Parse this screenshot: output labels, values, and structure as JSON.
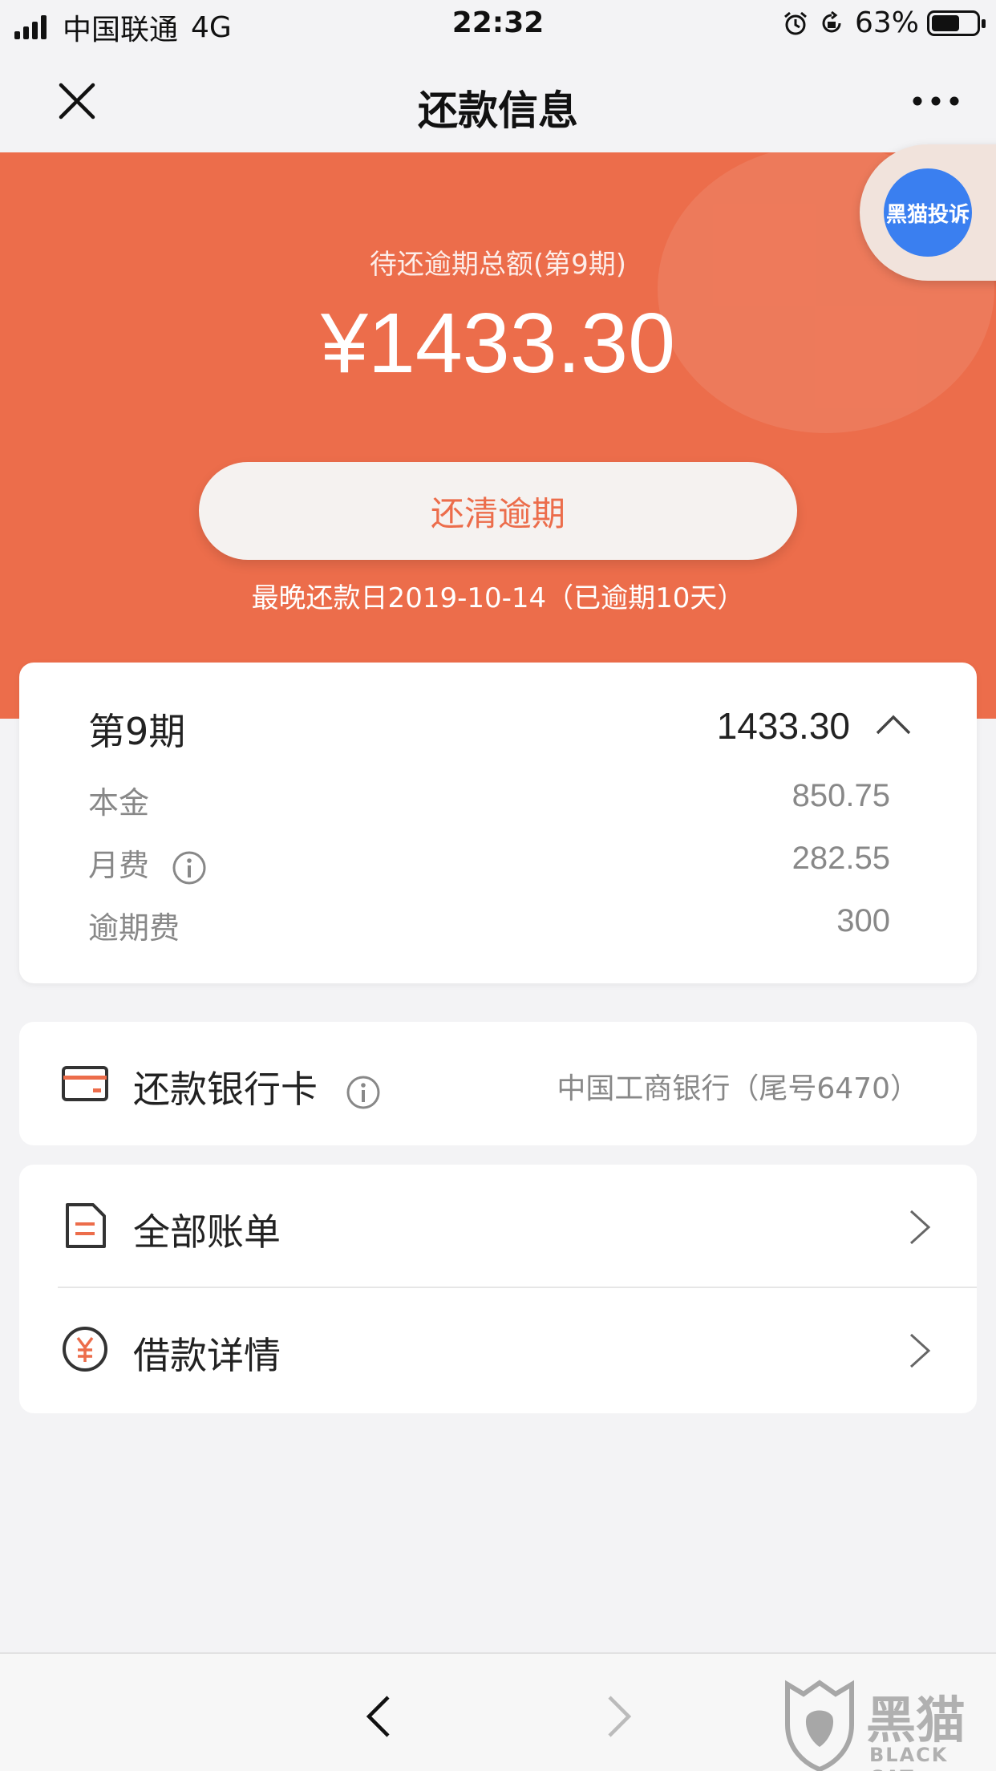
{
  "status_bar": {
    "carrier": "中国联通",
    "network": "4G",
    "time": "22:32",
    "battery": "63%",
    "battery_level": 0.63
  },
  "nav": {
    "title": "还款信息",
    "icons": [
      "close-icon",
      "more-icon"
    ]
  },
  "hero": {
    "label": "待还逾期总额(第9期)",
    "amount": "¥1433.30",
    "pay_button": "还清逾期",
    "due_note": "最晚还款日2019-10-14（已逾期10天）",
    "accent_color": "#ec6d4b"
  },
  "complaint_badge": {
    "label": "黑猫投诉",
    "color": "#3a7ff0"
  },
  "period": {
    "title": "第9期",
    "total": "1433.30",
    "rows": [
      {
        "label": "本金",
        "value": "850.75"
      },
      {
        "label": "月费",
        "value": "282.55"
      },
      {
        "label": "逾期费",
        "value": "300"
      }
    ]
  },
  "bank": {
    "label": "还款银行卡",
    "value": "中国工商银行（尾号6470）"
  },
  "menu": {
    "items": [
      {
        "label": "全部账单",
        "icon": "bill-icon"
      },
      {
        "label": "借款详情",
        "icon": "yuan-icon"
      }
    ]
  },
  "watermark": {
    "cn": "黑猫",
    "en": "BLACK CAT"
  }
}
